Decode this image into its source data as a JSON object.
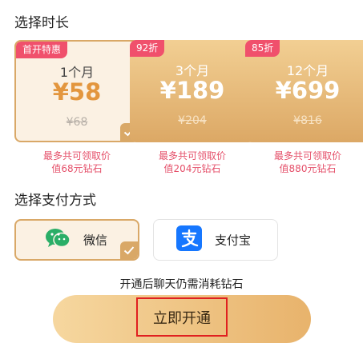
{
  "duration_section": {
    "title": "选择时长"
  },
  "plans": [
    {
      "badge": "首开特惠",
      "months": "1个月",
      "price": "¥58",
      "original_price": "¥68",
      "note_line1": "最多共可领取价",
      "note_line2": "值68元钻石",
      "selected": true
    },
    {
      "badge": "92折",
      "months": "3个月",
      "price": "¥189",
      "original_price": "¥204",
      "note_line1": "最多共可领取价",
      "note_line2": "值204元钻石",
      "selected": false
    },
    {
      "badge": "85折",
      "months": "12个月",
      "price": "¥699",
      "original_price": "¥816",
      "note_line1": "最多共可领取价",
      "note_line2": "值880元钻石",
      "selected": false
    }
  ],
  "payment_section": {
    "title": "选择支付方式"
  },
  "payment_methods": [
    {
      "label": "微信",
      "icon": "wechat-icon",
      "selected": true
    },
    {
      "label": "支付宝",
      "icon": "alipay-icon",
      "selected": false
    }
  ],
  "footer": {
    "hint": "开通后聊天仍需消耗钻石",
    "cta_label": "立即开通"
  },
  "colors": {
    "accent_gold": "#d9a867",
    "badge_red": "#f0506c",
    "note_pink": "#e5506a",
    "wechat_green": "#2aae67",
    "alipay_blue": "#1677ff",
    "highlight_red": "#e02020"
  }
}
